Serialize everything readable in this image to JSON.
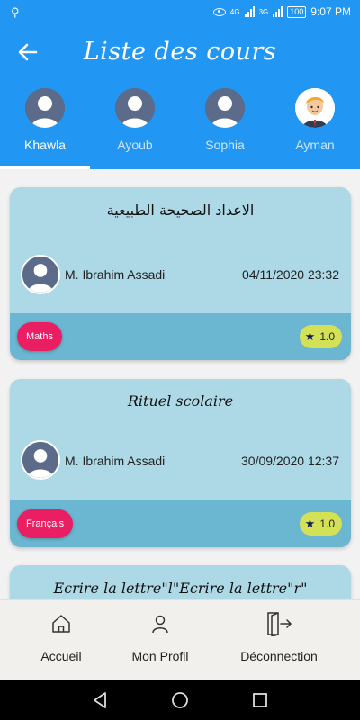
{
  "status_bar": {
    "time": "9:07 PM",
    "battery": "100",
    "net1": "4G",
    "net2": "3G"
  },
  "header": {
    "title": "Liste des cours",
    "back_icon": "arrow-left-icon",
    "color": "#2196f3"
  },
  "children": [
    {
      "name": "Khawla",
      "active": true
    },
    {
      "name": "Ayoub",
      "active": false
    },
    {
      "name": "Sophia",
      "active": false
    },
    {
      "name": "Ayman",
      "active": false
    }
  ],
  "courses": [
    {
      "title": "الاعداد الصحيحة الطبيعية",
      "teacher": "M. Ibrahim Assadi",
      "date": "04/11/2020 23:32",
      "subject": "Maths",
      "rating": "1.0"
    },
    {
      "title": "Rituel scolaire",
      "teacher": "M. Ibrahim Assadi",
      "date": "30/09/2020 12:37",
      "subject": "Français",
      "rating": "1.0"
    },
    {
      "title": "Ecrire la lettre\"l\"Ecrire la lettre\"r\"",
      "teacher": "",
      "date": "",
      "subject": "",
      "rating": ""
    }
  ],
  "bottom_nav": {
    "home": "Accueil",
    "profile": "Mon Profil",
    "logout": "Déconnection"
  },
  "colors": {
    "card_bg": "#add8e6",
    "card_band": "#6bb6d0",
    "subject_chip": "#e91e63",
    "rating_chip": "#d4e157"
  }
}
